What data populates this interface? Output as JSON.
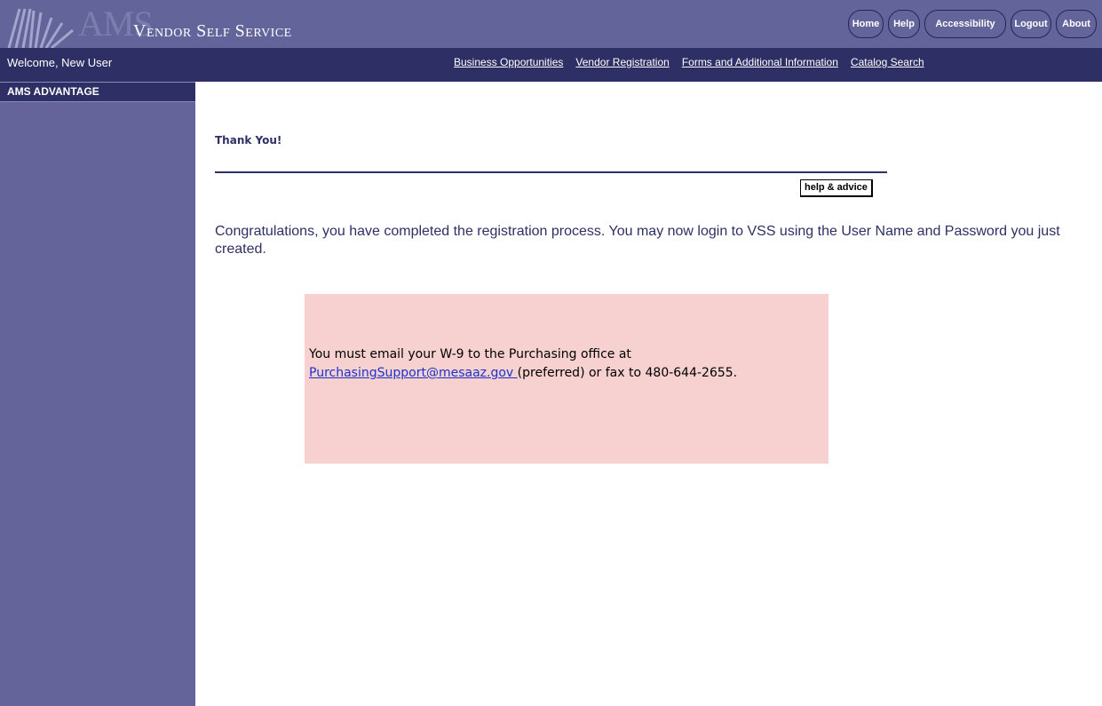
{
  "header": {
    "logo_text": "AMS",
    "app_title": "Vendor Self Service",
    "nav": {
      "home": "Home",
      "help": "Help",
      "accessibility": "Accessibility",
      "logout": "Logout",
      "about": "About"
    }
  },
  "subbar": {
    "welcome": "Welcome, New User",
    "links": {
      "business_opportunities": "Business Opportunities",
      "vendor_registration": "Vendor Registration",
      "forms_info": "Forms and Additional Information",
      "catalog_search": "Catalog Search"
    }
  },
  "sidebar": {
    "heading": "AMS ADVANTAGE"
  },
  "main": {
    "title": "Thank You!",
    "help_button": "help & advice",
    "message": "Congratulations, you have completed the registration process. You may now login to VSS using the User Name and Password you just created.",
    "notice": {
      "line1": "You must email your W-9 to the Purchasing office at",
      "email": "PurchasingSupport@mesaaz.gov ",
      "line2": "(preferred) or fax to 480-644-2655."
    }
  },
  "colors": {
    "banner": "#62649a",
    "subbar": "#2e2f64",
    "sidebar": "#64649a",
    "notice_bg": "#f6d1d0"
  }
}
